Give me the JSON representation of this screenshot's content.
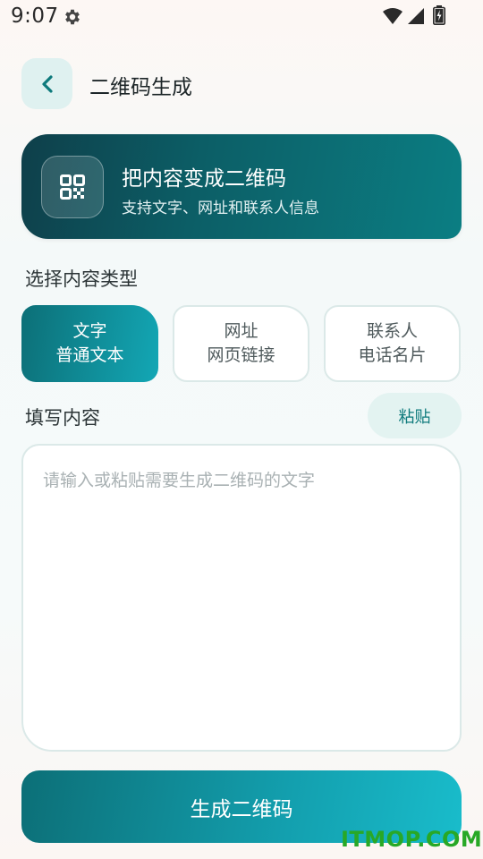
{
  "status_bar": {
    "time": "9:07",
    "icons": [
      "gear-icon",
      "wifi-icon",
      "cellular-signal-icon",
      "battery-charging-icon"
    ]
  },
  "header": {
    "back_icon": "chevron-left-icon",
    "title": "二维码生成"
  },
  "hero": {
    "icon": "qr-code-icon",
    "title": "把内容变成二维码",
    "subtitle": "支持文字、网址和联系人信息"
  },
  "type_section": {
    "label": "选择内容类型",
    "options": [
      {
        "title": "文字",
        "desc": "普通文本",
        "selected": true
      },
      {
        "title": "网址",
        "desc": "网页链接",
        "selected": false
      },
      {
        "title": "联系人",
        "desc": "电话名片",
        "selected": false
      }
    ]
  },
  "content_section": {
    "label": "填写内容",
    "paste_label": "粘贴",
    "placeholder": "请输入或粘贴需要生成二维码的文字",
    "value": ""
  },
  "generate_label": "生成二维码",
  "watermark": "ITMOP.COM",
  "colors": {
    "accent_dark": "#0e3f4a",
    "accent": "#0b7e83",
    "accent_light": "#19bccb",
    "soft_bg": "#dff1f0"
  }
}
